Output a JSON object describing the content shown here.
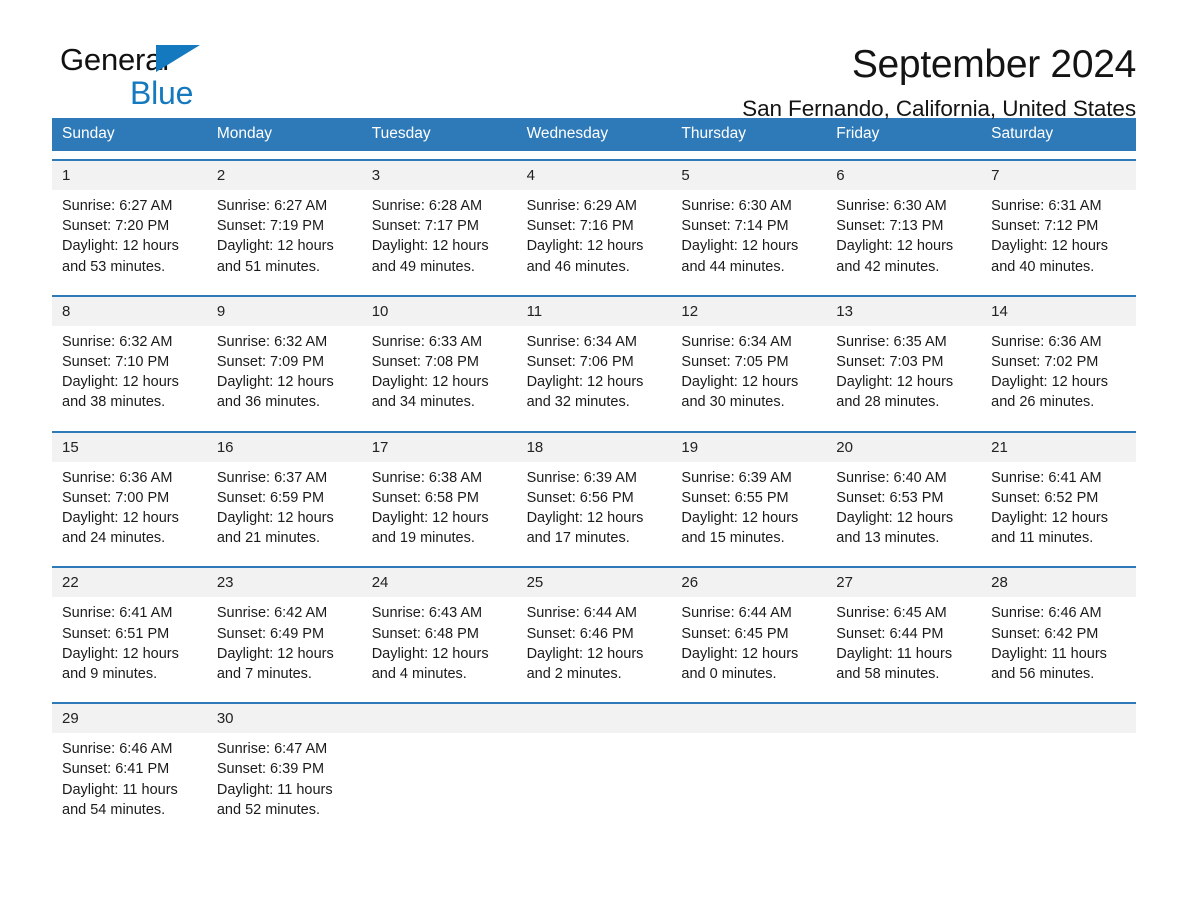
{
  "brand": {
    "name_part1": "General",
    "name_part2": "Blue",
    "triangle_color": "#1479bf"
  },
  "header": {
    "title": "September 2024",
    "subtitle": "San Fernando, California, United States"
  },
  "theme": {
    "header_blue": "#2e7ab8",
    "daynum_band": "#f2f2f2",
    "text": "#1b1b1b"
  },
  "weekdays": [
    "Sunday",
    "Monday",
    "Tuesday",
    "Wednesday",
    "Thursday",
    "Friday",
    "Saturday"
  ],
  "weeks": [
    {
      "days": [
        {
          "date": "1",
          "sunrise": "Sunrise: 6:27 AM",
          "sunset": "Sunset: 7:20 PM",
          "daylight_line1": "Daylight: 12 hours",
          "daylight_line2": "and 53 minutes."
        },
        {
          "date": "2",
          "sunrise": "Sunrise: 6:27 AM",
          "sunset": "Sunset: 7:19 PM",
          "daylight_line1": "Daylight: 12 hours",
          "daylight_line2": "and 51 minutes."
        },
        {
          "date": "3",
          "sunrise": "Sunrise: 6:28 AM",
          "sunset": "Sunset: 7:17 PM",
          "daylight_line1": "Daylight: 12 hours",
          "daylight_line2": "and 49 minutes."
        },
        {
          "date": "4",
          "sunrise": "Sunrise: 6:29 AM",
          "sunset": "Sunset: 7:16 PM",
          "daylight_line1": "Daylight: 12 hours",
          "daylight_line2": "and 46 minutes."
        },
        {
          "date": "5",
          "sunrise": "Sunrise: 6:30 AM",
          "sunset": "Sunset: 7:14 PM",
          "daylight_line1": "Daylight: 12 hours",
          "daylight_line2": "and 44 minutes."
        },
        {
          "date": "6",
          "sunrise": "Sunrise: 6:30 AM",
          "sunset": "Sunset: 7:13 PM",
          "daylight_line1": "Daylight: 12 hours",
          "daylight_line2": "and 42 minutes."
        },
        {
          "date": "7",
          "sunrise": "Sunrise: 6:31 AM",
          "sunset": "Sunset: 7:12 PM",
          "daylight_line1": "Daylight: 12 hours",
          "daylight_line2": "and 40 minutes."
        }
      ]
    },
    {
      "days": [
        {
          "date": "8",
          "sunrise": "Sunrise: 6:32 AM",
          "sunset": "Sunset: 7:10 PM",
          "daylight_line1": "Daylight: 12 hours",
          "daylight_line2": "and 38 minutes."
        },
        {
          "date": "9",
          "sunrise": "Sunrise: 6:32 AM",
          "sunset": "Sunset: 7:09 PM",
          "daylight_line1": "Daylight: 12 hours",
          "daylight_line2": "and 36 minutes."
        },
        {
          "date": "10",
          "sunrise": "Sunrise: 6:33 AM",
          "sunset": "Sunset: 7:08 PM",
          "daylight_line1": "Daylight: 12 hours",
          "daylight_line2": "and 34 minutes."
        },
        {
          "date": "11",
          "sunrise": "Sunrise: 6:34 AM",
          "sunset": "Sunset: 7:06 PM",
          "daylight_line1": "Daylight: 12 hours",
          "daylight_line2": "and 32 minutes."
        },
        {
          "date": "12",
          "sunrise": "Sunrise: 6:34 AM",
          "sunset": "Sunset: 7:05 PM",
          "daylight_line1": "Daylight: 12 hours",
          "daylight_line2": "and 30 minutes."
        },
        {
          "date": "13",
          "sunrise": "Sunrise: 6:35 AM",
          "sunset": "Sunset: 7:03 PM",
          "daylight_line1": "Daylight: 12 hours",
          "daylight_line2": "and 28 minutes."
        },
        {
          "date": "14",
          "sunrise": "Sunrise: 6:36 AM",
          "sunset": "Sunset: 7:02 PM",
          "daylight_line1": "Daylight: 12 hours",
          "daylight_line2": "and 26 minutes."
        }
      ]
    },
    {
      "days": [
        {
          "date": "15",
          "sunrise": "Sunrise: 6:36 AM",
          "sunset": "Sunset: 7:00 PM",
          "daylight_line1": "Daylight: 12 hours",
          "daylight_line2": "and 24 minutes."
        },
        {
          "date": "16",
          "sunrise": "Sunrise: 6:37 AM",
          "sunset": "Sunset: 6:59 PM",
          "daylight_line1": "Daylight: 12 hours",
          "daylight_line2": "and 21 minutes."
        },
        {
          "date": "17",
          "sunrise": "Sunrise: 6:38 AM",
          "sunset": "Sunset: 6:58 PM",
          "daylight_line1": "Daylight: 12 hours",
          "daylight_line2": "and 19 minutes."
        },
        {
          "date": "18",
          "sunrise": "Sunrise: 6:39 AM",
          "sunset": "Sunset: 6:56 PM",
          "daylight_line1": "Daylight: 12 hours",
          "daylight_line2": "and 17 minutes."
        },
        {
          "date": "19",
          "sunrise": "Sunrise: 6:39 AM",
          "sunset": "Sunset: 6:55 PM",
          "daylight_line1": "Daylight: 12 hours",
          "daylight_line2": "and 15 minutes."
        },
        {
          "date": "20",
          "sunrise": "Sunrise: 6:40 AM",
          "sunset": "Sunset: 6:53 PM",
          "daylight_line1": "Daylight: 12 hours",
          "daylight_line2": "and 13 minutes."
        },
        {
          "date": "21",
          "sunrise": "Sunrise: 6:41 AM",
          "sunset": "Sunset: 6:52 PM",
          "daylight_line1": "Daylight: 12 hours",
          "daylight_line2": "and 11 minutes."
        }
      ]
    },
    {
      "days": [
        {
          "date": "22",
          "sunrise": "Sunrise: 6:41 AM",
          "sunset": "Sunset: 6:51 PM",
          "daylight_line1": "Daylight: 12 hours",
          "daylight_line2": "and 9 minutes."
        },
        {
          "date": "23",
          "sunrise": "Sunrise: 6:42 AM",
          "sunset": "Sunset: 6:49 PM",
          "daylight_line1": "Daylight: 12 hours",
          "daylight_line2": "and 7 minutes."
        },
        {
          "date": "24",
          "sunrise": "Sunrise: 6:43 AM",
          "sunset": "Sunset: 6:48 PM",
          "daylight_line1": "Daylight: 12 hours",
          "daylight_line2": "and 4 minutes."
        },
        {
          "date": "25",
          "sunrise": "Sunrise: 6:44 AM",
          "sunset": "Sunset: 6:46 PM",
          "daylight_line1": "Daylight: 12 hours",
          "daylight_line2": "and 2 minutes."
        },
        {
          "date": "26",
          "sunrise": "Sunrise: 6:44 AM",
          "sunset": "Sunset: 6:45 PM",
          "daylight_line1": "Daylight: 12 hours",
          "daylight_line2": "and 0 minutes."
        },
        {
          "date": "27",
          "sunrise": "Sunrise: 6:45 AM",
          "sunset": "Sunset: 6:44 PM",
          "daylight_line1": "Daylight: 11 hours",
          "daylight_line2": "and 58 minutes."
        },
        {
          "date": "28",
          "sunrise": "Sunrise: 6:46 AM",
          "sunset": "Sunset: 6:42 PM",
          "daylight_line1": "Daylight: 11 hours",
          "daylight_line2": "and 56 minutes."
        }
      ]
    },
    {
      "days": [
        {
          "date": "29",
          "sunrise": "Sunrise: 6:46 AM",
          "sunset": "Sunset: 6:41 PM",
          "daylight_line1": "Daylight: 11 hours",
          "daylight_line2": "and 54 minutes."
        },
        {
          "date": "30",
          "sunrise": "Sunrise: 6:47 AM",
          "sunset": "Sunset: 6:39 PM",
          "daylight_line1": "Daylight: 11 hours",
          "daylight_line2": "and 52 minutes."
        },
        {
          "date": "",
          "sunrise": "",
          "sunset": "",
          "daylight_line1": "",
          "daylight_line2": ""
        },
        {
          "date": "",
          "sunrise": "",
          "sunset": "",
          "daylight_line1": "",
          "daylight_line2": ""
        },
        {
          "date": "",
          "sunrise": "",
          "sunset": "",
          "daylight_line1": "",
          "daylight_line2": ""
        },
        {
          "date": "",
          "sunrise": "",
          "sunset": "",
          "daylight_line1": "",
          "daylight_line2": ""
        },
        {
          "date": "",
          "sunrise": "",
          "sunset": "",
          "daylight_line1": "",
          "daylight_line2": ""
        }
      ]
    }
  ]
}
